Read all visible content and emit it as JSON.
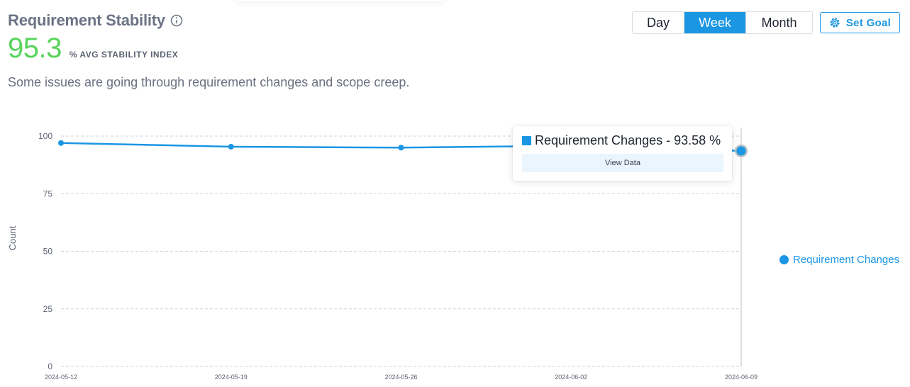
{
  "header": {
    "title": "Requirement Stability",
    "metric_value": "95.3",
    "metric_unit": "% AVG STABILITY INDEX",
    "description": "Some issues are going through requirement changes and scope creep."
  },
  "range_selector": {
    "options": [
      "Day",
      "Week",
      "Month"
    ],
    "selected": "Week"
  },
  "set_goal_label": "Set Goal",
  "tooltip": {
    "label": "Requirement Changes - 93.58 %",
    "button_label": "View Data"
  },
  "legend": {
    "label": "Requirement Changes"
  },
  "colors": {
    "accent": "#1a96e3",
    "metric": "#58d35b"
  },
  "chart_data": {
    "type": "line",
    "ylabel": "Count",
    "xlabel": "",
    "ylim": [
      0,
      100
    ],
    "yticks": [
      0,
      25,
      50,
      75,
      100
    ],
    "xticks": [
      "2024-05-12",
      "2024-05-19",
      "2024-05-26",
      "2024-06-02",
      "2024-06-09"
    ],
    "grid": true,
    "legend_position": "right",
    "series": [
      {
        "name": "Requirement Changes",
        "x": [
          "2024-05-12",
          "2024-05-19",
          "2024-05-26",
          "2024-06-02",
          "2024-06-09"
        ],
        "values": [
          97.0,
          95.4,
          95.0,
          95.8,
          93.58
        ]
      }
    ]
  }
}
